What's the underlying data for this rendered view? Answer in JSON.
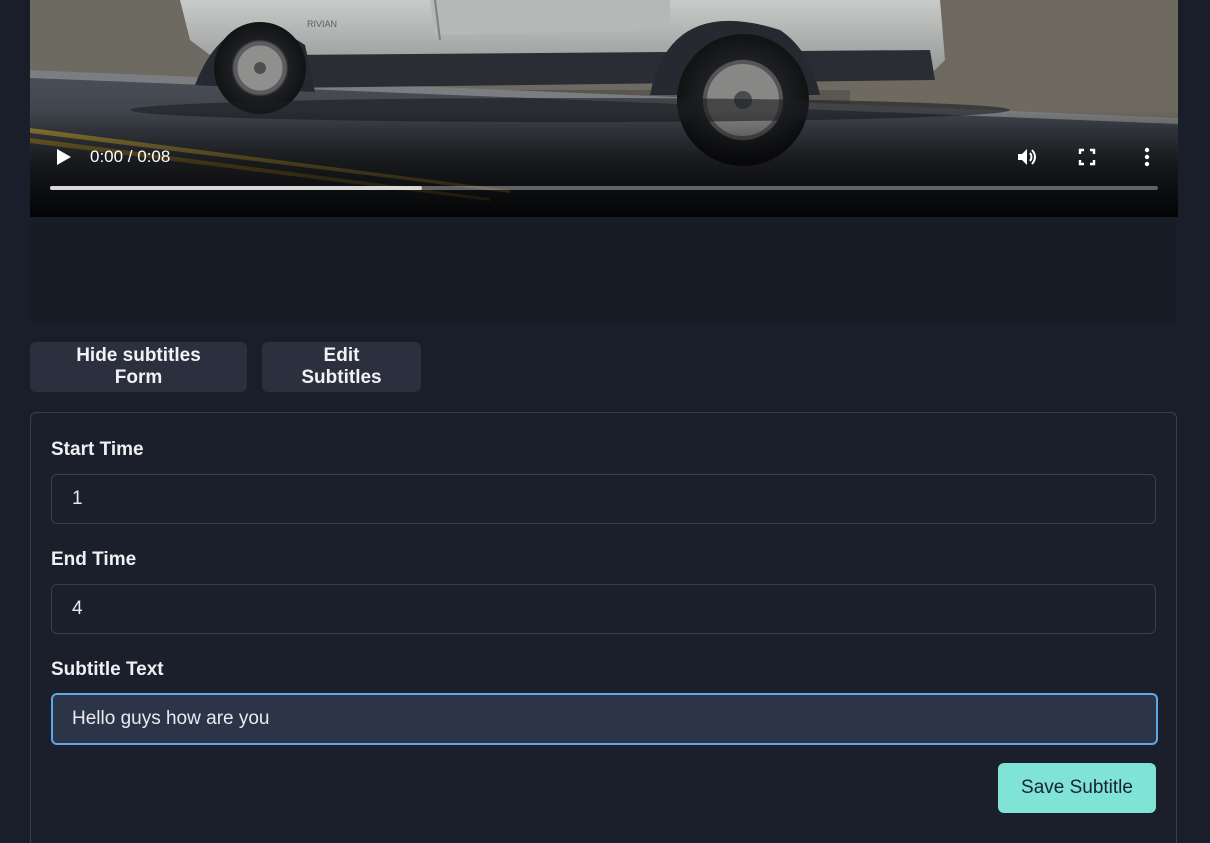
{
  "video": {
    "time_display": "0:00 / 0:08",
    "progress_fraction": 0.336,
    "icons": [
      "play-icon",
      "volume-icon",
      "fullscreen-icon",
      "more-options-icon"
    ],
    "car_badge": "RIVIAN"
  },
  "actions": {
    "hide_form_label": "Hide subtitles Form",
    "edit_subtitles_label": "Edit Subtitles"
  },
  "form": {
    "start_time": {
      "label": "Start Time",
      "value": "1"
    },
    "end_time": {
      "label": "End Time",
      "value": "4"
    },
    "subtitle_text": {
      "label": "Subtitle Text",
      "value": "Hello guys how are you"
    },
    "save_label": "Save Subtitle"
  },
  "colors": {
    "background": "#1a1e2b",
    "button_dark": "#2c303e",
    "accent_save": "#7fe3d6",
    "focus_ring": "#5ea6e6"
  }
}
